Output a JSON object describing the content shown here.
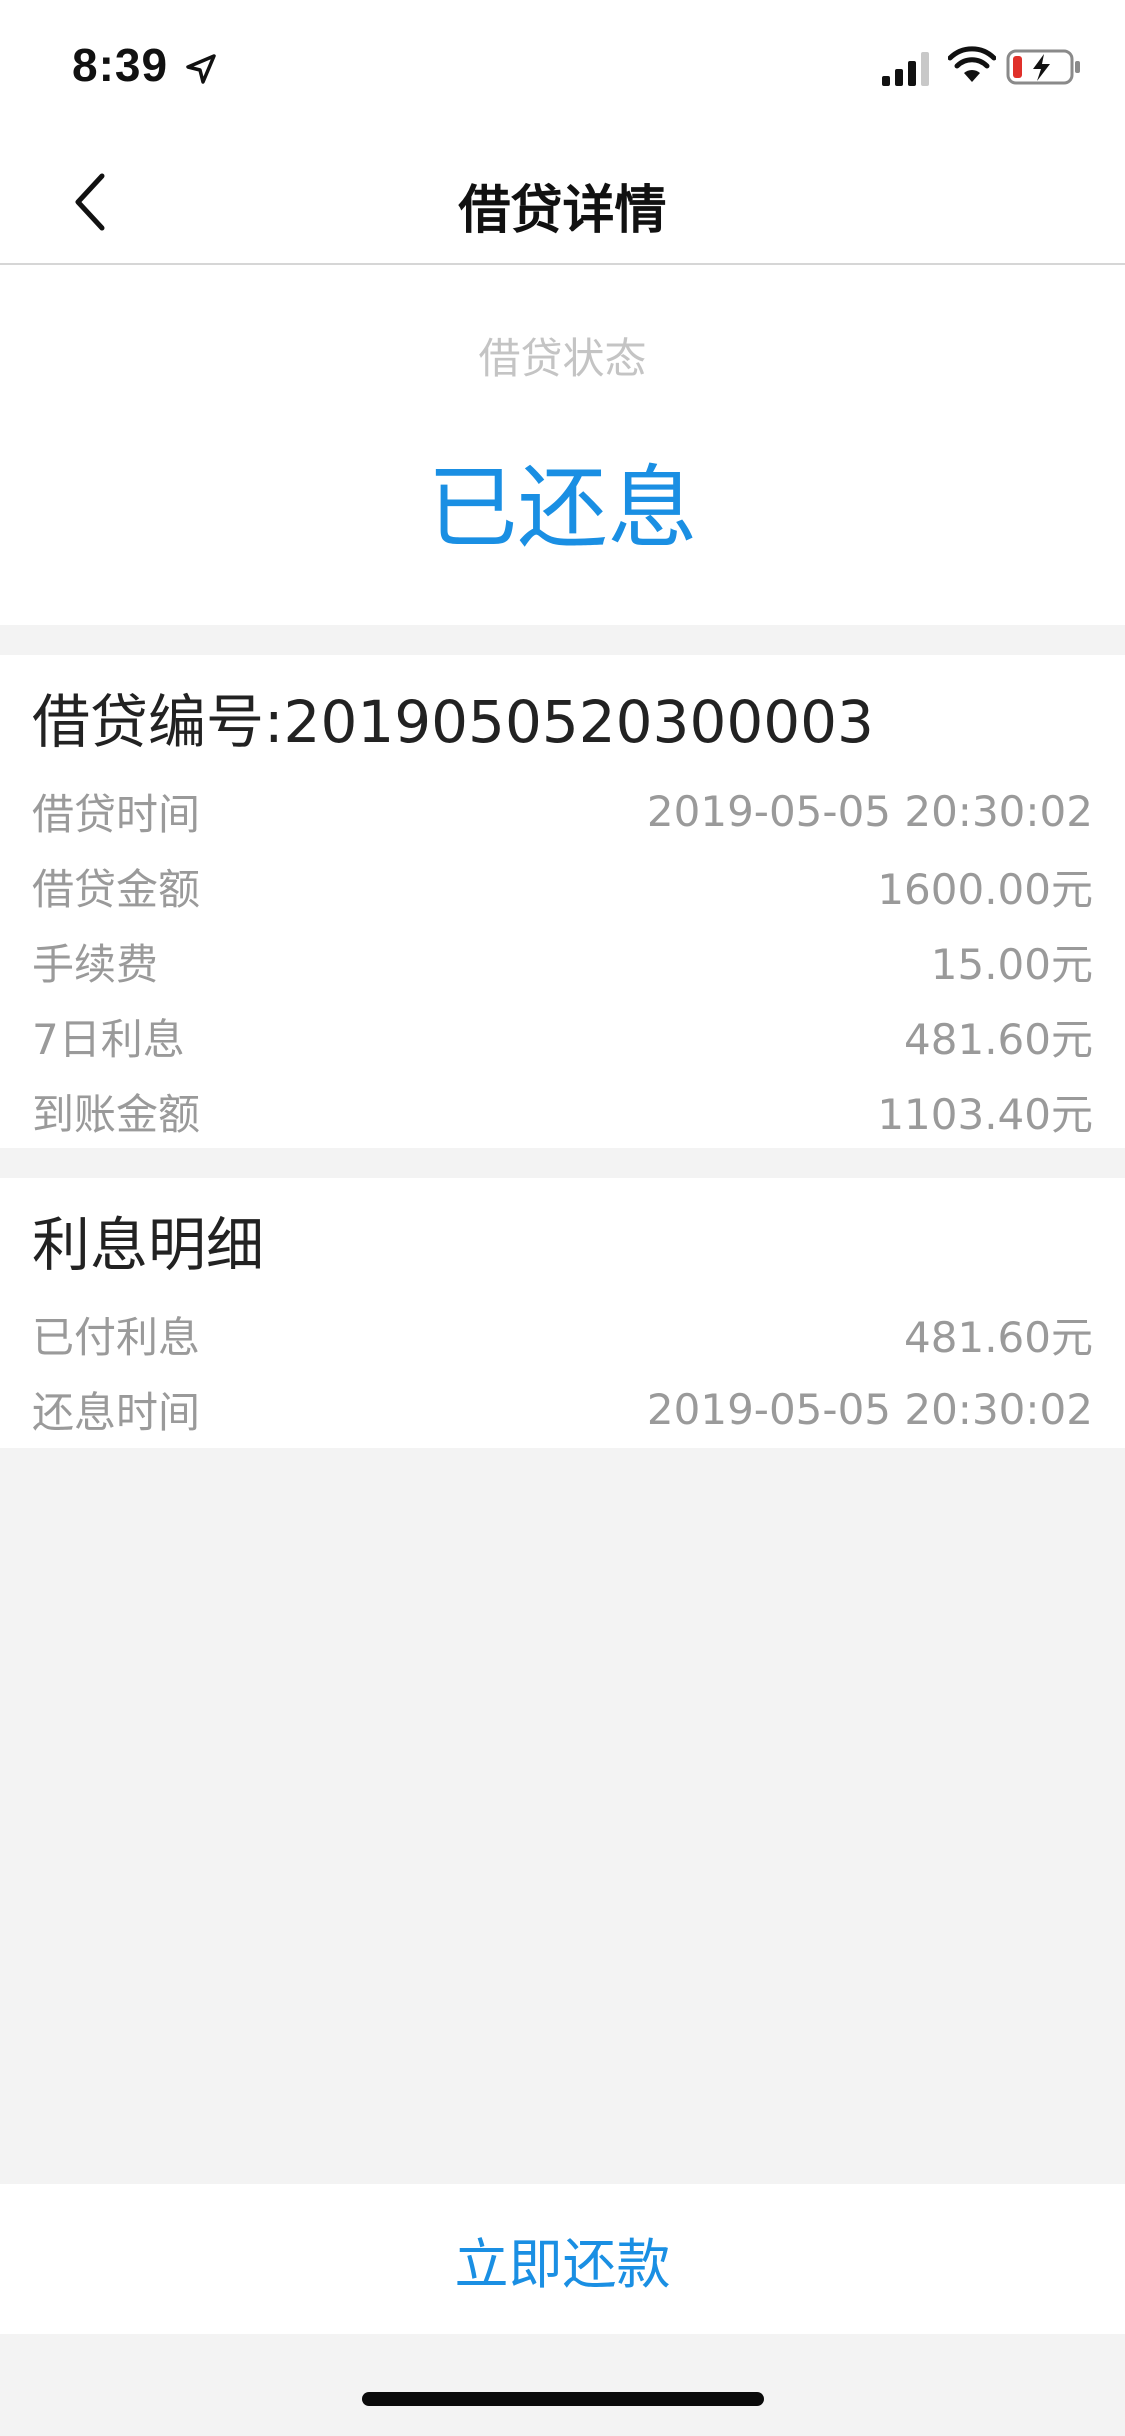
{
  "status_bar": {
    "time": "8:39",
    "icons": [
      "location-arrow-icon",
      "cellular-signal-icon",
      "wifi-icon",
      "battery-charging-icon"
    ]
  },
  "nav": {
    "title": "借贷详情",
    "back_icon": "chevron-left-icon"
  },
  "status": {
    "label": "借贷状态",
    "value": "已还息",
    "accent_color": "#1a8fe3"
  },
  "loan": {
    "title": "借贷编号:2019050520300003",
    "rows": [
      {
        "label": "借贷时间",
        "value": "2019-05-05 20:30:02"
      },
      {
        "label": "借贷金额",
        "value": "1600.00元"
      },
      {
        "label": "手续费",
        "value": "15.00元"
      },
      {
        "label": "7日利息",
        "value": "481.60元"
      },
      {
        "label": "到账金额",
        "value": "1103.40元"
      }
    ]
  },
  "interest": {
    "title": "利息明细",
    "rows": [
      {
        "label": "已付利息",
        "value": "481.60元"
      },
      {
        "label": "还息时间",
        "value": "2019-05-05 20:30:02"
      }
    ]
  },
  "footer": {
    "repay_label": "立即还款"
  }
}
